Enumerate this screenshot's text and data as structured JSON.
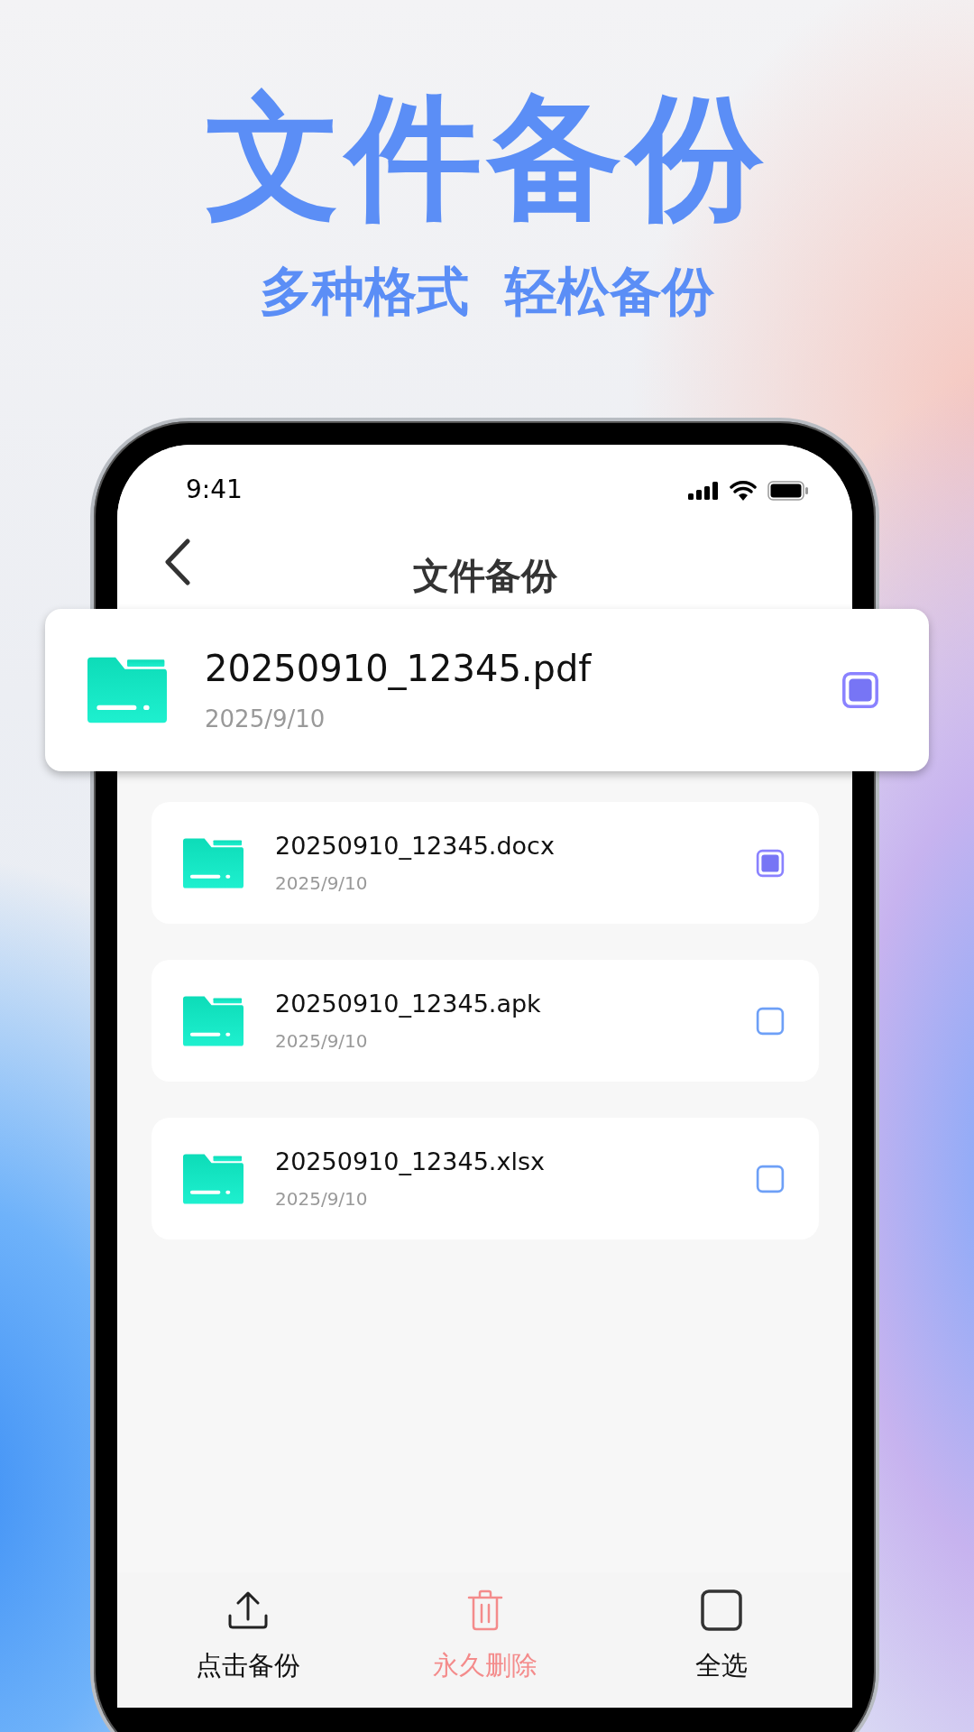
{
  "headline": "文件备份",
  "subtitle": "多种格式  轻松备份",
  "status_bar": {
    "time": "9:41"
  },
  "nav": {
    "title": "文件备份"
  },
  "featured_file": {
    "name": "20250910_12345.pdf",
    "date": "2025/9/10",
    "checked": true
  },
  "files": [
    {
      "name": "20250910_12345.docx",
      "date": "2025/9/10",
      "checked": true
    },
    {
      "name": "20250910_12345.apk",
      "date": "2025/9/10",
      "checked": false
    },
    {
      "name": "20250910_12345.xlsx",
      "date": "2025/9/10",
      "checked": false
    }
  ],
  "actions": [
    {
      "kind": "upload",
      "label": "点击备份"
    },
    {
      "kind": "delete",
      "label": "永久删除"
    },
    {
      "kind": "select",
      "label": "全选"
    }
  ]
}
